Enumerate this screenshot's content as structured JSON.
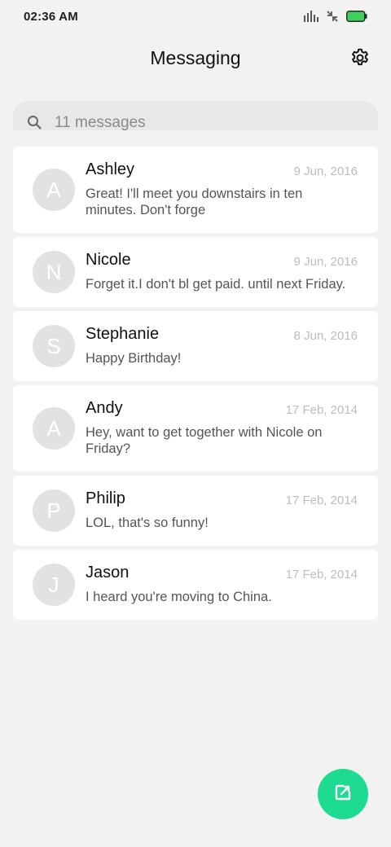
{
  "status_bar": {
    "time": "02:36 AM"
  },
  "header": {
    "title": "Messaging",
    "settings_icon": "gear-icon"
  },
  "search": {
    "placeholder": "11 messages"
  },
  "conversations": [
    {
      "initial": "A",
      "name": "Ashley",
      "date": "9 Jun, 2016",
      "preview": "Great! I'll meet you downstairs in ten minutes. Don't forge"
    },
    {
      "initial": "N",
      "name": "Nicole",
      "date": "9 Jun, 2016",
      "preview": "Forget it.I don't bl get paid. until next Friday."
    },
    {
      "initial": "S",
      "name": "Stephanie",
      "date": "8 Jun, 2016",
      "preview": "Happy Birthday!"
    },
    {
      "initial": "A",
      "name": "Andy",
      "date": "17 Feb, 2014",
      "preview": "Hey, want to get together with Nicole on Friday?"
    },
    {
      "initial": "P",
      "name": "Philip",
      "date": "17 Feb, 2014",
      "preview": "LOL, that's so funny!"
    },
    {
      "initial": "J",
      "name": "Jason",
      "date": "17 Feb, 2014",
      "preview": "I heard you're moving to China."
    }
  ],
  "colors": {
    "accent": "#1ddc92",
    "background": "#f2f2f2",
    "card": "#ffffff",
    "avatar": "#e2e2e2"
  },
  "fab": {
    "icon": "compose-icon"
  }
}
